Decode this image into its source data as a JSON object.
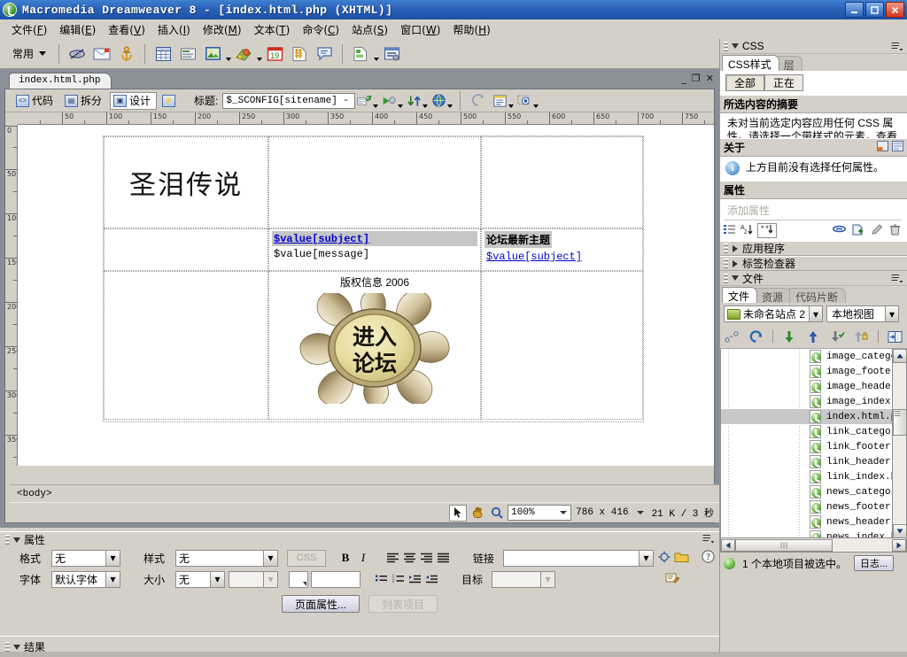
{
  "window": {
    "title": "Macromedia Dreamweaver 8 - [index.html.php (XHTML)]",
    "minimize": "_",
    "maximize": "❐",
    "close": "✕"
  },
  "menubar": {
    "items": [
      {
        "label": "文件",
        "key": "F"
      },
      {
        "label": "编辑",
        "key": "E"
      },
      {
        "label": "查看",
        "key": "V"
      },
      {
        "label": "插入",
        "key": "I"
      },
      {
        "label": "修改",
        "key": "M"
      },
      {
        "label": "文本",
        "key": "T"
      },
      {
        "label": "命令",
        "key": "C"
      },
      {
        "label": "站点",
        "key": "S"
      },
      {
        "label": "窗口",
        "key": "W"
      },
      {
        "label": "帮助",
        "key": "H"
      }
    ]
  },
  "insertbar": {
    "category": "常用",
    "icons": [
      "hyperlink-icon",
      "email-link-icon",
      "named-anchor-icon",
      "table-icon",
      "insert-div-icon",
      "image-icon",
      "media-icon",
      "date-icon",
      "server-side-include-icon",
      "comment-icon",
      "templates-icon",
      "tag-chooser-icon"
    ]
  },
  "document": {
    "tab_label": "index.html.php",
    "win_minimize": "_",
    "win_restore": "❐",
    "win_close": "✕",
    "view_buttons": [
      {
        "label": "代码",
        "icon": "code-view-icon",
        "active": false
      },
      {
        "label": "拆分",
        "icon": "split-view-icon",
        "active": false
      },
      {
        "label": "设计",
        "icon": "design-view-icon",
        "active": true
      }
    ],
    "live_data_icon": "live-data-icon",
    "title_label": "标题:",
    "title_value": "$_SCONFIG[sitename] - Pow",
    "toolbar_icons": [
      "file-management-icon",
      "preview-in-browser-icon",
      "refresh-design-view-icon",
      "validate-markup-icon",
      "check-browser-support-icon",
      "visual-aids-icon"
    ],
    "ruler_h_ticks": [
      "50",
      "100",
      "150",
      "200",
      "250",
      "300",
      "350",
      "400",
      "450",
      "500",
      "550",
      "600",
      "650",
      "700",
      "750"
    ],
    "ruler_v_ticks": [
      "0",
      "50",
      "100",
      "150",
      "200",
      "250",
      "300",
      "350",
      "400"
    ]
  },
  "page": {
    "site_title": "圣泪传说",
    "thread_subject_selected": "$value[subject]",
    "thread_message": "$value[message]",
    "forum_latest_heading": "论坛最新主题",
    "forum_latest_link": "$value[subject]",
    "copyright": "版权信息 2006",
    "enter_forum_line1": "进入",
    "enter_forum_line2": "论坛"
  },
  "tagbar": {
    "selector": "<body>"
  },
  "doc_status": {
    "tools": [
      "select-tool-icon",
      "hand-tool-icon",
      "zoom-tool-icon"
    ],
    "zoom": "100%",
    "window_size": "786 x 416",
    "download_size": "21 K / 3 秒"
  },
  "properties": {
    "panel_title": "属性",
    "format_label": "格式",
    "format_value": "无",
    "style_label": "样式",
    "style_value": "无",
    "css_button": "CSS",
    "bold": "B",
    "italic": "I",
    "font_label": "字体",
    "font_value": "默认字体",
    "size_label": "大小",
    "size_value": "无",
    "size_unit_value": "",
    "color_value": "",
    "link_label": "链接",
    "link_value": "",
    "target_label": "目标",
    "target_value": "",
    "page_properties_button": "页面属性...",
    "list_item_button": "列表项目",
    "align_icons": [
      "align-left-icon",
      "align-center-icon",
      "align-right-icon",
      "align-justify-icon"
    ],
    "list_icons": [
      "unordered-list-icon",
      "ordered-list-icon",
      "outdent-icon",
      "indent-icon"
    ],
    "help_icon": "help-icon",
    "quick_tag_icon": "quick-tag-editor-icon"
  },
  "results": {
    "label": "结果"
  },
  "css_panel": {
    "header": "CSS",
    "tabs": [
      {
        "label": "CSS样式",
        "active": true
      },
      {
        "label": "层",
        "active": false
      }
    ],
    "seg_buttons": [
      {
        "label": "全部",
        "active": true
      },
      {
        "label": "正在",
        "active": false
      }
    ],
    "summary_header": "所选内容的摘要",
    "summary_text": "未对当前选定内容应用任何 CSS 属性。请选择一个带样式的元素，查看应用了哪些 CSS 属性。",
    "about_header": "关于",
    "about_text": "上方目前没有选择任何属性。",
    "properties_header": "属性",
    "add_property_placeholder": "添加属性",
    "view_icons": [
      "show-category-view-icon",
      "show-list-view-icon"
    ],
    "prop_tool_icons": [
      "category-view-icon",
      "list-view-icon",
      "set-properties-icon",
      "attach-style-sheet-icon",
      "new-css-rule-icon",
      "edit-style-icon",
      "delete-property-icon"
    ]
  },
  "collapsed_panels": [
    {
      "label": "应用程序"
    },
    {
      "label": "标签检查器"
    }
  ],
  "files_panel": {
    "header": "文件",
    "tabs": [
      {
        "label": "文件",
        "active": true
      },
      {
        "label": "资源",
        "active": false
      },
      {
        "label": "代码片断",
        "active": false
      }
    ],
    "site_value": "未命名站点 2",
    "view_value": "本地视图",
    "toolbar_icons": [
      "connect-to-remote-host-icon",
      "refresh-icon",
      "get-files-icon",
      "put-files-icon",
      "check-out-files-icon",
      "check-in-files-icon",
      "expand-collapse-icon"
    ],
    "files": [
      {
        "name": "image_categor",
        "selected": false
      },
      {
        "name": "image_footer.",
        "selected": false
      },
      {
        "name": "image_header.",
        "selected": false
      },
      {
        "name": "image_index.h",
        "selected": false
      },
      {
        "name": "index.html.ph",
        "selected": true
      },
      {
        "name": "link_category",
        "selected": false
      },
      {
        "name": "link_footer.h",
        "selected": false
      },
      {
        "name": "link_header.h",
        "selected": false
      },
      {
        "name": "link_index.ht",
        "selected": false
      },
      {
        "name": "news_category",
        "selected": false
      },
      {
        "name": "news_footer.h",
        "selected": false
      },
      {
        "name": "news_header.h",
        "selected": false
      },
      {
        "name": "news_index.ht",
        "selected": false
      }
    ],
    "status_text": "1 个本地项目被选中。",
    "log_button": "日志..."
  },
  "colors": {
    "titlebar_start": "#4080d0",
    "titlebar_end": "#1d50a8",
    "panel_bg": "#d4d0c8",
    "link": "#0000cc",
    "selection": "#c6c6c6"
  }
}
